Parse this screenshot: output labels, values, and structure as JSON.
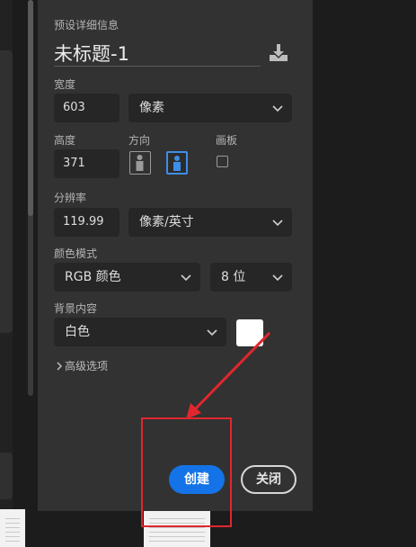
{
  "preset_label": "预设详细信息",
  "document_title": "未标题-1",
  "width": {
    "label": "宽度",
    "value": "603",
    "unit": "像素"
  },
  "height": {
    "label": "高度",
    "value": "371"
  },
  "orientation": {
    "label": "方向",
    "selected": "landscape"
  },
  "artboard": {
    "label": "画板",
    "checked": false
  },
  "resolution": {
    "label": "分辨率",
    "value": "119.99",
    "unit": "像素/英寸"
  },
  "color_mode": {
    "label": "颜色模式",
    "mode": "RGB 颜色",
    "depth": "8 位"
  },
  "background": {
    "label": "背景内容",
    "value": "白色",
    "swatch_color": "#ffffff"
  },
  "advanced_label": "高级选项",
  "buttons": {
    "create": "创建",
    "close": "关闭"
  },
  "colors": {
    "accent": "#1473e6",
    "annotation": "#e0272d",
    "panel": "#323232"
  },
  "icons": [
    "save-preset-icon",
    "chevron-down-icon",
    "portrait-orientation-icon",
    "landscape-orientation-icon",
    "chevron-right-icon"
  ]
}
